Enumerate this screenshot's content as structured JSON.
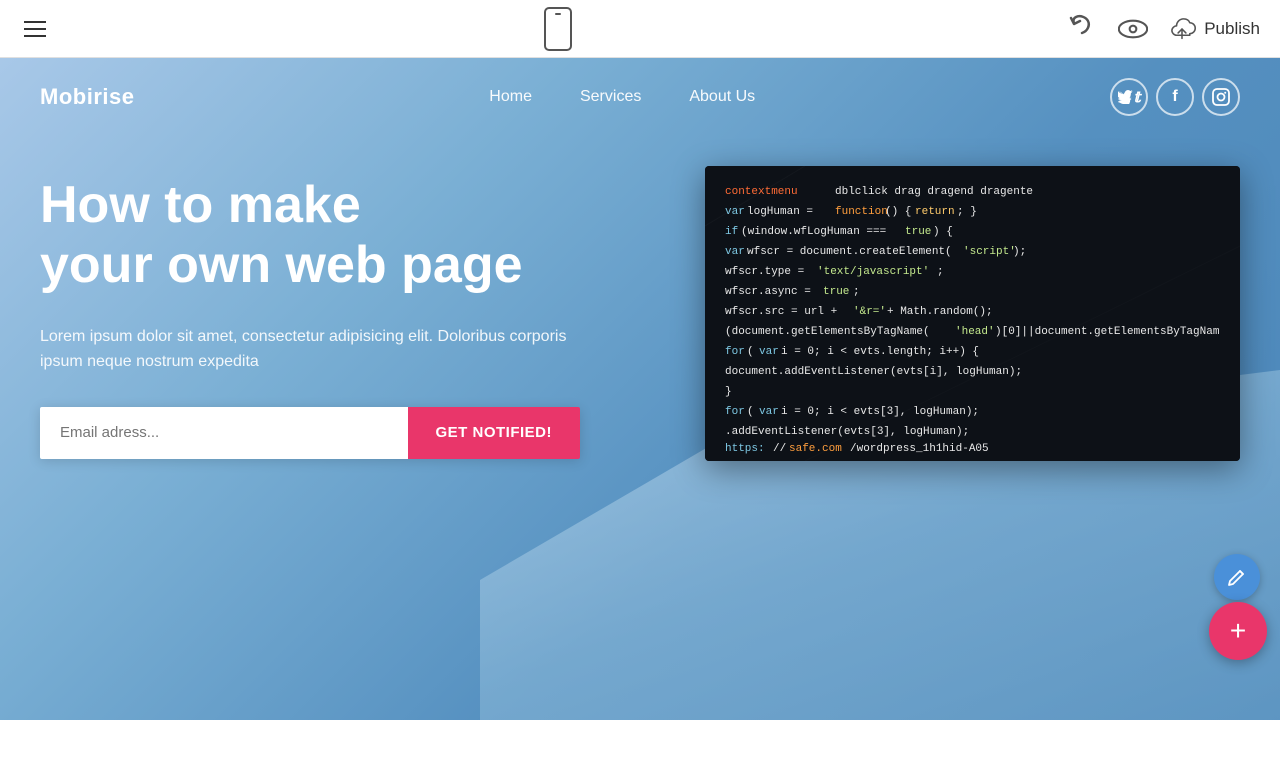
{
  "toolbar": {
    "hamburger_label": "menu",
    "phone_label": "mobile preview",
    "undo_label": "undo",
    "preview_label": "preview",
    "publish_label": "Publish"
  },
  "site": {
    "logo": "Mobirise",
    "nav": {
      "home": "Home",
      "services": "Services",
      "about": "About Us"
    },
    "social": {
      "twitter": "T",
      "facebook": "f",
      "instagram": "in"
    }
  },
  "hero": {
    "headline_line1": "How to make",
    "headline_line2": "your own web page",
    "subtext": "Lorem ipsum dolor sit amet, consectetur adipisicing elit. Doloribus corporis ipsum neque nostrum expedita",
    "email_placeholder": "Email adress...",
    "cta_button": "GET NOTIFIED!"
  },
  "fabs": {
    "pencil_label": "edit",
    "add_label": "add"
  },
  "colors": {
    "accent_pink": "#e9366a",
    "accent_blue": "#4a90d9",
    "nav_bg": "#fff",
    "hero_bg_start": "#a8c8e8",
    "logo_color": "#fff"
  }
}
